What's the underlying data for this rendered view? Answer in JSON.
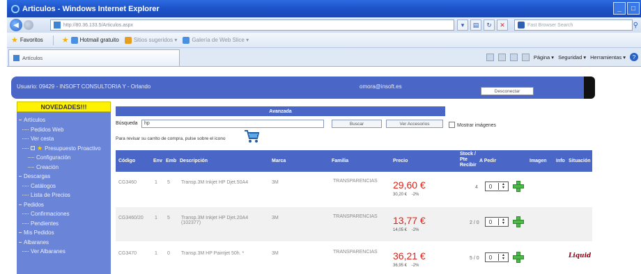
{
  "window": {
    "title": "Articulos - Windows Internet Explorer",
    "address": "http://80.36.133.5/Articulos.aspx",
    "search_placeholder": "Fast Browser Search"
  },
  "favorites": {
    "label": "Favoritos",
    "items": [
      "Hotmail gratuito",
      "Sitios sugeridos ▾",
      "Galería de Web Slice ▾"
    ]
  },
  "tab": {
    "label": "Artículos"
  },
  "commandbar": {
    "page": "Página ▾",
    "security": "Seguridad ▾",
    "tools": "Herramientas ▾"
  },
  "userbar": {
    "user": "Usuario: 09429 - INSOFT CONSULTORIA Y - Orlando",
    "email": "omora@insoft.es",
    "logout": "Desconectar"
  },
  "sidebar": {
    "novedades": "NOVEDADES!!!",
    "items": [
      {
        "label": "Artículos",
        "level": 0
      },
      {
        "label": "Pedidos Web",
        "level": 1
      },
      {
        "label": "Ver cesta",
        "level": 1
      },
      {
        "label": "Presupuesto Proactivo",
        "level": 1
      },
      {
        "label": "Configuración",
        "level": 2
      },
      {
        "label": "Creación",
        "level": 2
      },
      {
        "label": "Descargas",
        "level": 0
      },
      {
        "label": "Catálogos",
        "level": 1
      },
      {
        "label": "Lista de Precios",
        "level": 1
      },
      {
        "label": "Pedidos",
        "level": 0
      },
      {
        "label": "Confirmaciones",
        "level": 1
      },
      {
        "label": "Pendientes",
        "level": 1
      },
      {
        "label": "Mis Pedidos",
        "level": 0
      },
      {
        "label": "Albaranes",
        "level": 0
      },
      {
        "label": "Ver Albaranes",
        "level": 1
      }
    ]
  },
  "search": {
    "header": "Avanzada",
    "label": "Búsqueda",
    "value": "hp",
    "search_button": "Buscar",
    "accessories_button": "Ver Accesorios",
    "show_images": "Mostrar imágenes",
    "cart_hint": "Para revisar su carrito de compra, pulse sobre el icono"
  },
  "table": {
    "headers": {
      "codigo": "Código",
      "env": "Env",
      "emb": "Emb",
      "descripcion": "Descripción",
      "marca": "Marca",
      "familia": "Familia",
      "precio": "Precio",
      "stock": "Stock / Pte Recibir",
      "pedir": "A Pedir",
      "imagen": "Imagen",
      "info": "Info",
      "situacion": "Situación"
    },
    "rows": [
      {
        "codigo": "CG3460",
        "env": "1",
        "emb": "5",
        "descripcion": "Transp.3M Inkjet HP Djet.50A4",
        "marca": "3M",
        "familia": "TRANSPARENCIAS",
        "precio": "29,60 €",
        "precio_base": "30,20 €",
        "descuento": "-2%",
        "stock": "4",
        "qty": "0",
        "logo": ""
      },
      {
        "codigo": "CG3460/20",
        "env": "1",
        "emb": "5",
        "descripcion": "Transp.3M Inkjet HP Djet.20A4 (102377)",
        "marca": "3M",
        "familia": "TRANSPARENCIAS",
        "precio": "13,77 €",
        "precio_base": "14,05 €",
        "descuento": "-2%",
        "stock": "2 / 0",
        "qty": "0",
        "logo": ""
      },
      {
        "codigo": "CG3470",
        "env": "1",
        "emb": "0",
        "descripcion": "Transp.3M HP Paintjet 50h. *",
        "marca": "3M",
        "familia": "TRANSPARENCIAS",
        "precio": "36,21 €",
        "precio_base": "36,95 €",
        "descuento": "-2%",
        "stock": "5 / 0",
        "qty": "0",
        "logo": "Liquid"
      }
    ]
  }
}
